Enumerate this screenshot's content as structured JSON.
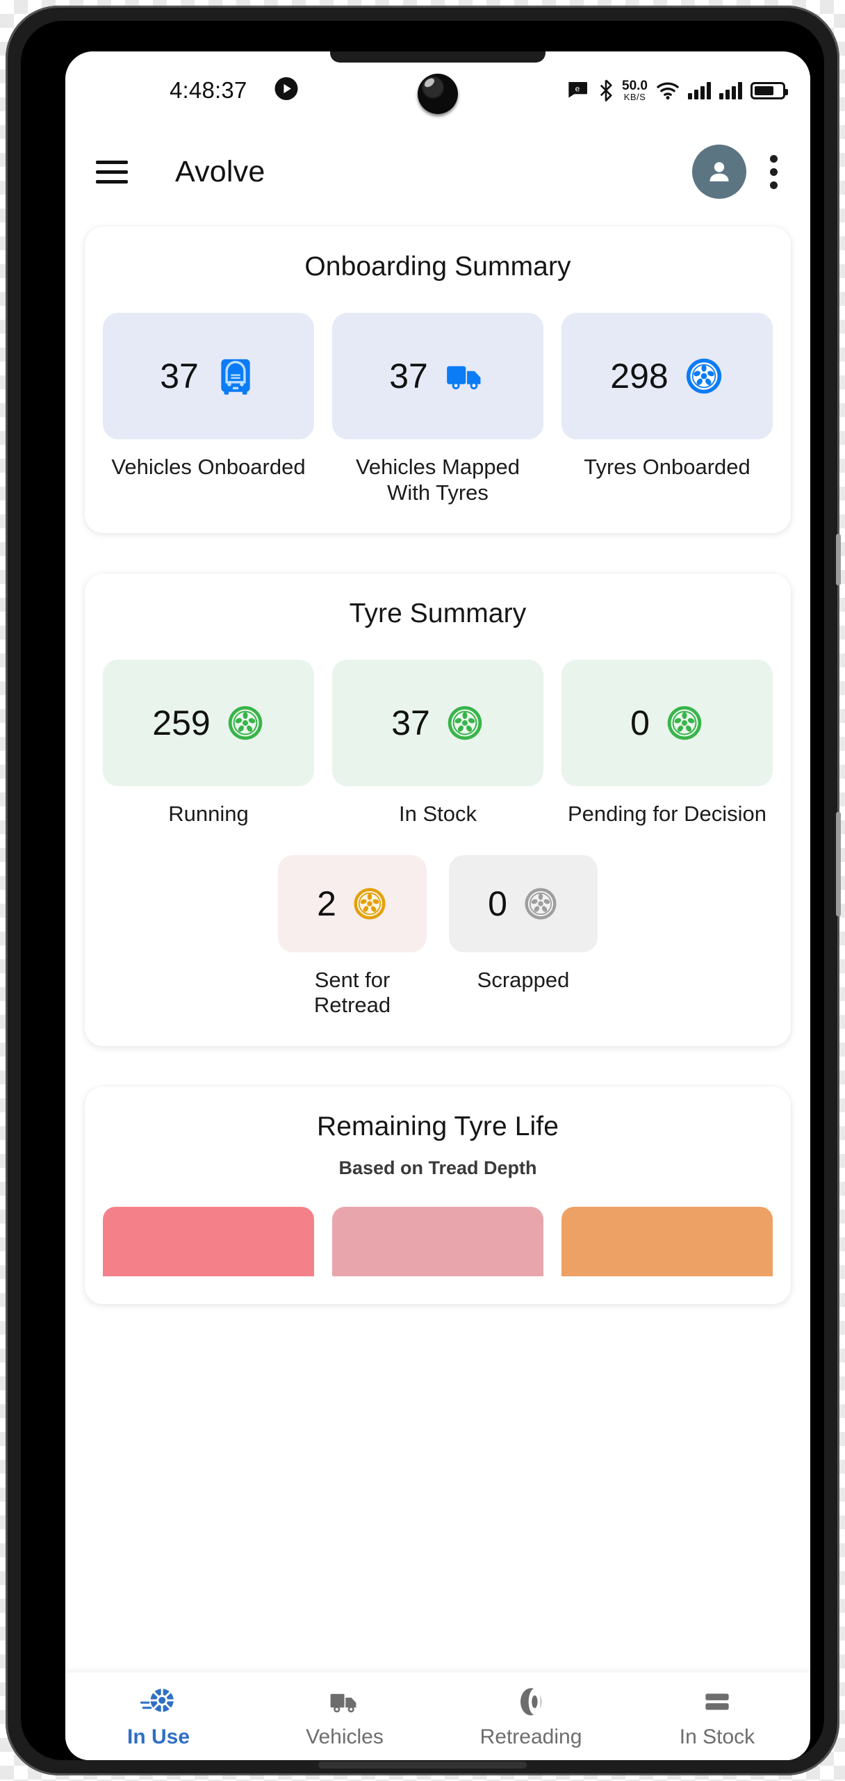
{
  "status_bar": {
    "time": "4:48:37",
    "play_icon": "play-circle-icon",
    "camera_icon": "camera-punch-hole",
    "message_icon": "message-icon",
    "bluetooth_icon": "bluetooth-icon",
    "net_speed_value": "50.0",
    "net_speed_unit": "KB/S",
    "wifi_icon": "wifi-icon",
    "signal1_icon": "cellular-signal-icon",
    "signal2_icon": "cellular-signal-icon",
    "battery_icon": "battery-icon"
  },
  "app_bar": {
    "menu_icon": "hamburger-menu-icon",
    "title": "Avolve",
    "avatar_icon": "user-avatar-icon",
    "overflow_icon": "more-vertical-icon"
  },
  "onboarding_summary": {
    "title": "Onboarding Summary",
    "stats": [
      {
        "value": "37",
        "label": "Vehicles Onboarded",
        "icon": "bus-front-icon",
        "tone": "blue"
      },
      {
        "value": "37",
        "label": "Vehicles Mapped With Tyres",
        "icon": "truck-side-icon",
        "tone": "blue"
      },
      {
        "value": "298",
        "label": "Tyres Onboarded",
        "icon": "tyre-wheel-icon",
        "tone": "blue"
      }
    ]
  },
  "tyre_summary": {
    "title": "Tyre Summary",
    "stats_row1": [
      {
        "value": "259",
        "label": "Running",
        "icon": "tyre-wheel-icon",
        "tone": "green"
      },
      {
        "value": "37",
        "label": "In Stock",
        "icon": "tyre-wheel-icon",
        "tone": "green"
      },
      {
        "value": "0",
        "label": "Pending for Decision",
        "icon": "tyre-wheel-icon",
        "tone": "green"
      }
    ],
    "stats_row2": [
      {
        "value": "2",
        "label": "Sent for Retread",
        "icon": "tyre-wheel-icon",
        "tone": "pink"
      },
      {
        "value": "0",
        "label": "Scrapped",
        "icon": "tyre-wheel-icon",
        "tone": "grey"
      }
    ]
  },
  "remaining_tyre_life": {
    "title": "Remaining Tyre Life",
    "subtitle": "Based on Tread Depth",
    "bars": [
      {
        "color": "#f4818a"
      },
      {
        "color": "#e8a6ac"
      },
      {
        "color": "#eda164"
      }
    ]
  },
  "bottom_nav": {
    "items": [
      {
        "label": "In Use",
        "icon": "tyre-motion-icon",
        "active": true
      },
      {
        "label": "Vehicles",
        "icon": "truck-icon",
        "active": false
      },
      {
        "label": "Retreading",
        "icon": "retread-icon",
        "active": false
      },
      {
        "label": "In Stock",
        "icon": "stack-icon",
        "active": false
      }
    ]
  },
  "colors": {
    "accent_blue": "#2f6fc4",
    "icon_blue": "#0b7cf5",
    "icon_green": "#38b44a",
    "icon_amber": "#e3a008",
    "icon_grey": "#9e9e9e",
    "tile_blue": "#e6eaf7",
    "tile_green": "#e9f4ec",
    "tile_pink": "#f8eeee",
    "tile_grey": "#efefef"
  }
}
